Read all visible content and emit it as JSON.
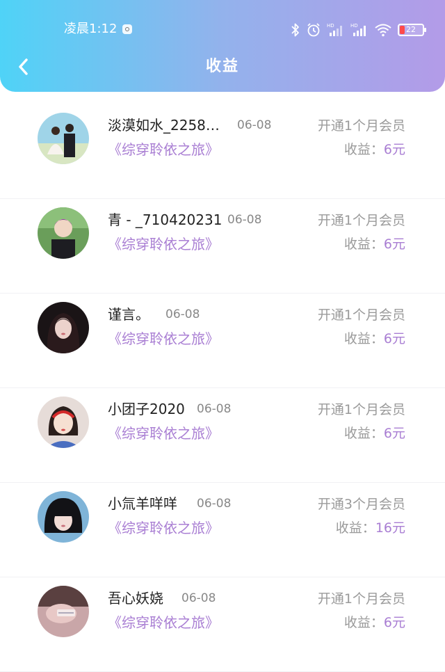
{
  "status_bar": {
    "time": "凌晨1:12",
    "battery": "22"
  },
  "header": {
    "title": "收益"
  },
  "earnings_label": "收益：",
  "items": [
    {
      "name": "淡漠如水_2258…",
      "date": "06-08",
      "book": "《综穿聆依之旅》",
      "membership": "开通1个月会员",
      "amount": "6元"
    },
    {
      "name": "青 - _710420231",
      "date": "06-08",
      "book": "《综穿聆依之旅》",
      "membership": "开通1个月会员",
      "amount": "6元"
    },
    {
      "name": "谨言。",
      "date": "06-08",
      "book": "《综穿聆依之旅》",
      "membership": "开通1个月会员",
      "amount": "6元"
    },
    {
      "name": "小团子2020",
      "date": "06-08",
      "book": "《综穿聆依之旅》",
      "membership": "开通1个月会员",
      "amount": "6元"
    },
    {
      "name": "小氚羊咩咩",
      "date": "06-08",
      "book": "《综穿聆依之旅》",
      "membership": "开通3个月会员",
      "amount": "16元"
    },
    {
      "name": "吾心妖娆",
      "date": "06-08",
      "book": "《综穿聆依之旅》",
      "membership": "开通1个月会员",
      "amount": "6元"
    }
  ],
  "colors": {
    "header_gradient_start": "#4fd3f7",
    "header_gradient_end": "#b39be8",
    "accent_purple": "#a97ed3",
    "muted_text": "#9a9a9a",
    "battery_low": "#ff4a4a"
  }
}
